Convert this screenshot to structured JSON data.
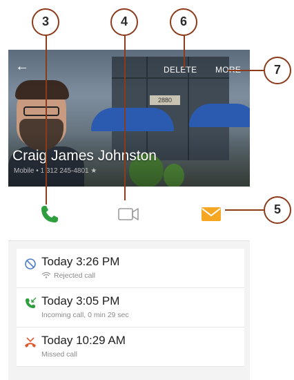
{
  "header": {
    "back_icon": "back-arrow-icon",
    "delete_label": "DELETE",
    "more_label": "MORE",
    "storefront_sign": "2880"
  },
  "contact": {
    "name": "Craig James Johnston",
    "subtitle": "Mobile • 1 312 245-4801  ★"
  },
  "actions": {
    "call_icon": "phone-icon",
    "video_icon": "video-call-icon",
    "message_icon": "message-envelope-icon",
    "call_color": "#2e9e3e",
    "message_color": "#f5a623"
  },
  "call_log": [
    {
      "icon": "blocked-icon",
      "time": "Today 3:26 PM",
      "desc": "Rejected call",
      "color": "#4a7cc9",
      "show_wifi": true
    },
    {
      "icon": "incoming-call-icon",
      "time": "Today 3:05 PM",
      "desc": "Incoming call, 0 min 29 sec",
      "color": "#2e9e3e",
      "show_wifi": false
    },
    {
      "icon": "missed-call-icon",
      "time": "Today 10:29 AM",
      "desc": "Missed call",
      "color": "#e05a30",
      "show_wifi": false
    }
  ],
  "callouts": {
    "c3": "3",
    "c4": "4",
    "c5": "5",
    "c6": "6",
    "c7": "7"
  }
}
